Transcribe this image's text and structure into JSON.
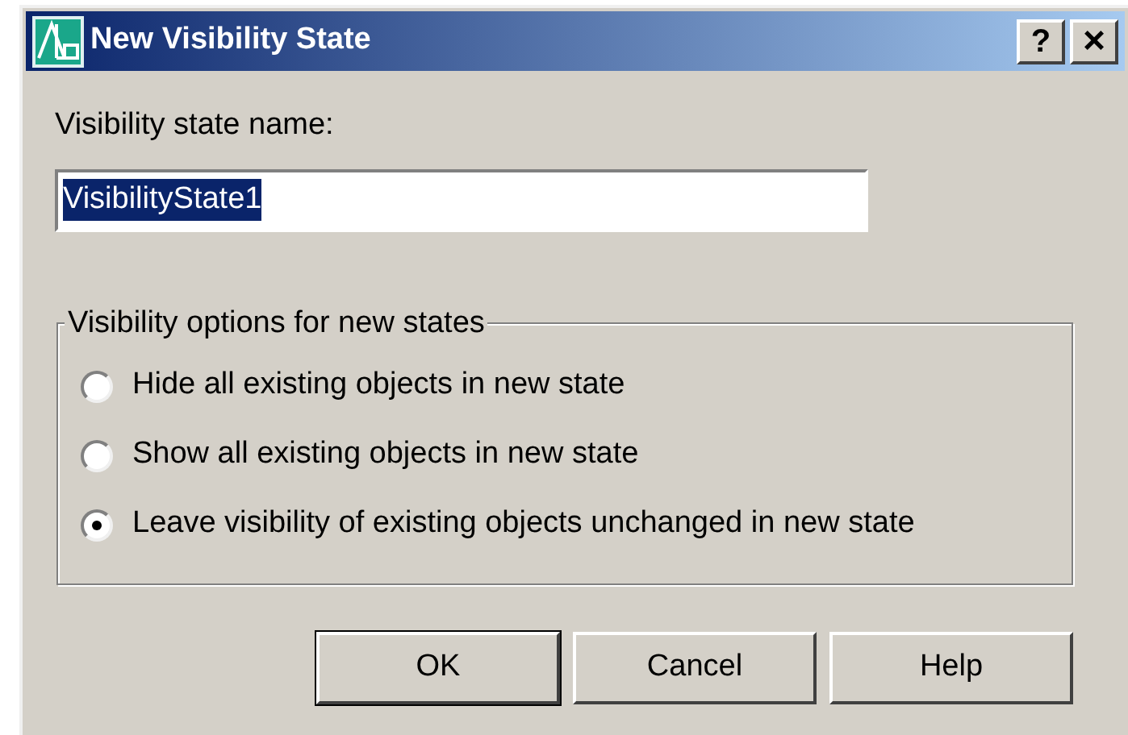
{
  "window": {
    "title": "New Visibility State",
    "buttons": [
      {
        "kind": "help",
        "label": "?"
      },
      {
        "kind": "close",
        "label": "×"
      }
    ]
  },
  "name_field": {
    "label": "Visibility state name:",
    "value": "VisibilityState1",
    "selected": true
  },
  "options": {
    "title": "Visibility options for new states",
    "items": [
      {
        "label": "Hide all existing objects in new state",
        "selected": false
      },
      {
        "label": "Show all existing objects in new state",
        "selected": false
      },
      {
        "label": "Leave visibility of existing objects unchanged in new state",
        "selected": true
      }
    ]
  },
  "buttons": [
    {
      "label": "OK",
      "default": true
    },
    {
      "label": "Cancel",
      "default": false
    },
    {
      "label": "Help",
      "default": false
    }
  ]
}
